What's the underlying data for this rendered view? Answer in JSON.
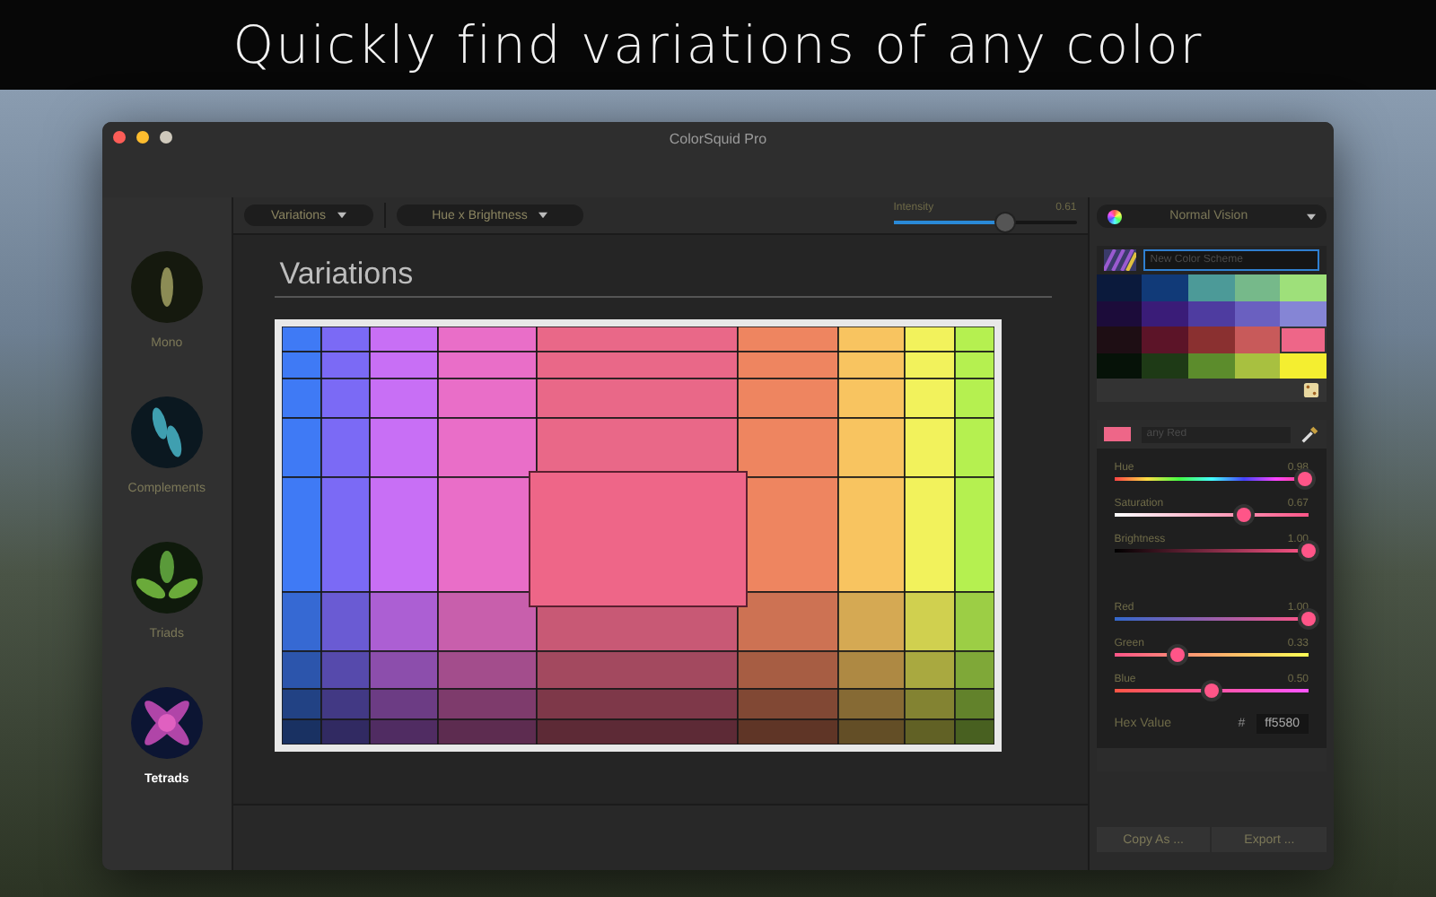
{
  "headline": "Quickly find variations of any color",
  "window": {
    "title": "ColorSquid Pro"
  },
  "sidebar": {
    "items": [
      {
        "label": "Mono",
        "kind": "mono",
        "selected": false
      },
      {
        "label": "Complements",
        "kind": "complements",
        "selected": false
      },
      {
        "label": "Triads",
        "kind": "triads",
        "selected": false
      },
      {
        "label": "Tetrads",
        "kind": "tetrads",
        "selected": true
      }
    ]
  },
  "toolbar": {
    "mode": "Variations",
    "axes": "Hue x Brightness",
    "intensity": {
      "label": "Intensity",
      "reading": "0.61",
      "level": 0.61
    }
  },
  "main": {
    "title": "Variations"
  },
  "vision": {
    "label": "Normal Vision"
  },
  "scheme": {
    "placeholder": "New Color Scheme"
  },
  "palette": [
    {
      "color": "#0b1a3c",
      "selected": false
    },
    {
      "color": "#113a78",
      "selected": false
    },
    {
      "color": "#4c9a98",
      "selected": false
    },
    {
      "color": "#76b98a",
      "selected": false
    },
    {
      "color": "#9ee07a",
      "selected": false
    },
    {
      "color": "#1c0c3a",
      "selected": false
    },
    {
      "color": "#3a1c78",
      "selected": false
    },
    {
      "color": "#4e3ca0",
      "selected": false
    },
    {
      "color": "#6a60c0",
      "selected": false
    },
    {
      "color": "#8585d5",
      "selected": false
    },
    {
      "color": "#1e0e14",
      "selected": false
    },
    {
      "color": "#5c1428",
      "selected": false
    },
    {
      "color": "#8a3030",
      "selected": false
    },
    {
      "color": "#c85a5a",
      "selected": false
    },
    {
      "color": "#ee6688",
      "selected": true
    },
    {
      "color": "#061208",
      "selected": false
    },
    {
      "color": "#1e3a16",
      "selected": false
    },
    {
      "color": "#5c8c2c",
      "selected": false
    },
    {
      "color": "#a8c040",
      "selected": false
    },
    {
      "color": "#f4ee30",
      "selected": false
    }
  ],
  "color": {
    "placeholder": "any Red",
    "sliders": [
      {
        "label": "Hue",
        "kind": "hue",
        "reading": "0.98",
        "level": 0.98
      },
      {
        "label": "Saturation",
        "kind": "saturation",
        "reading": "0.67",
        "level": 0.67
      },
      {
        "label": "Brightness",
        "kind": "brightness",
        "reading": "1.00",
        "level": 1.0
      },
      {
        "label": "Red",
        "kind": "red",
        "reading": "1.00",
        "level": 1.0
      },
      {
        "label": "Green",
        "kind": "green",
        "reading": "0.33",
        "level": 0.33
      },
      {
        "label": "Blue",
        "kind": "blue",
        "reading": "0.50",
        "level": 0.5
      }
    ],
    "hex_label": "Hex Value",
    "hash": "#",
    "hex": "ff5580"
  },
  "buttons": [
    "Copy As ...",
    "Export ..."
  ]
}
